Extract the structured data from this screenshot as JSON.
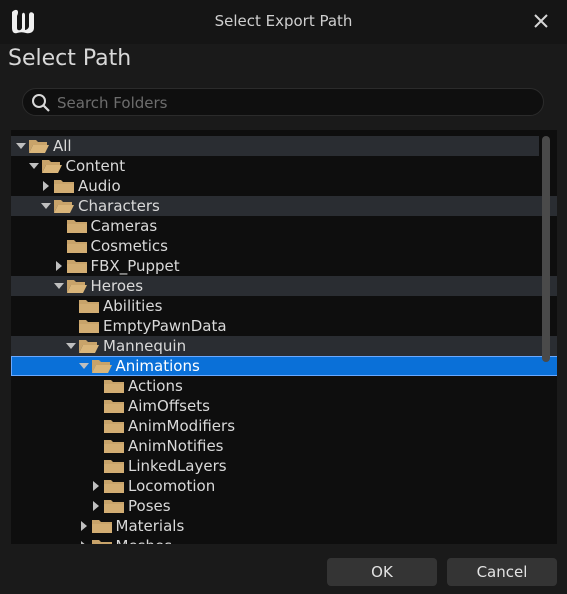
{
  "window": {
    "title": "Select Export Path",
    "subtitle": "Select Path",
    "logo_icon": "unreal-logo-icon",
    "close_icon": "close-icon"
  },
  "search": {
    "placeholder": "Search Folders",
    "value": "",
    "icon": "search-icon"
  },
  "tree": {
    "rows": [
      {
        "label": "All",
        "depth": 0,
        "expander": "expanded",
        "folder": "open",
        "shaded": true,
        "selected": false
      },
      {
        "label": "Content",
        "depth": 1,
        "expander": "expanded",
        "folder": "open",
        "shaded": false,
        "selected": false
      },
      {
        "label": "Audio",
        "depth": 2,
        "expander": "collapsed",
        "folder": "closed",
        "shaded": false,
        "selected": false
      },
      {
        "label": "Characters",
        "depth": 2,
        "expander": "expanded",
        "folder": "open",
        "shaded": true,
        "selected": false
      },
      {
        "label": "Cameras",
        "depth": 3,
        "expander": "none",
        "folder": "closed",
        "shaded": false,
        "selected": false
      },
      {
        "label": "Cosmetics",
        "depth": 3,
        "expander": "none",
        "folder": "closed",
        "shaded": false,
        "selected": false
      },
      {
        "label": "FBX_Puppet",
        "depth": 3,
        "expander": "collapsed",
        "folder": "closed",
        "shaded": false,
        "selected": false
      },
      {
        "label": "Heroes",
        "depth": 3,
        "expander": "expanded",
        "folder": "open",
        "shaded": true,
        "selected": false
      },
      {
        "label": "Abilities",
        "depth": 4,
        "expander": "none",
        "folder": "closed",
        "shaded": false,
        "selected": false
      },
      {
        "label": "EmptyPawnData",
        "depth": 4,
        "expander": "none",
        "folder": "closed",
        "shaded": false,
        "selected": false
      },
      {
        "label": "Mannequin",
        "depth": 4,
        "expander": "expanded",
        "folder": "open",
        "shaded": true,
        "selected": false
      },
      {
        "label": "Animations",
        "depth": 5,
        "expander": "expanded",
        "folder": "open",
        "shaded": false,
        "selected": true
      },
      {
        "label": "Actions",
        "depth": 6,
        "expander": "none",
        "folder": "closed",
        "shaded": false,
        "selected": false
      },
      {
        "label": "AimOffsets",
        "depth": 6,
        "expander": "none",
        "folder": "closed",
        "shaded": false,
        "selected": false
      },
      {
        "label": "AnimModifiers",
        "depth": 6,
        "expander": "none",
        "folder": "closed",
        "shaded": false,
        "selected": false
      },
      {
        "label": "AnimNotifies",
        "depth": 6,
        "expander": "none",
        "folder": "closed",
        "shaded": false,
        "selected": false
      },
      {
        "label": "LinkedLayers",
        "depth": 6,
        "expander": "none",
        "folder": "closed",
        "shaded": false,
        "selected": false
      },
      {
        "label": "Locomotion",
        "depth": 6,
        "expander": "collapsed",
        "folder": "closed",
        "shaded": false,
        "selected": false
      },
      {
        "label": "Poses",
        "depth": 6,
        "expander": "collapsed",
        "folder": "closed",
        "shaded": false,
        "selected": false
      },
      {
        "label": "Materials",
        "depth": 5,
        "expander": "collapsed",
        "folder": "closed",
        "shaded": false,
        "selected": false
      },
      {
        "label": "Meshes",
        "depth": 5,
        "expander": "collapsed",
        "folder": "closed",
        "shaded": false,
        "selected": false
      }
    ]
  },
  "buttons": {
    "ok": "OK",
    "cancel": "Cancel"
  },
  "colors": {
    "folder": "#c8a36a",
    "selection": "#0a70d8",
    "shaded_row": "#2a2d32"
  }
}
